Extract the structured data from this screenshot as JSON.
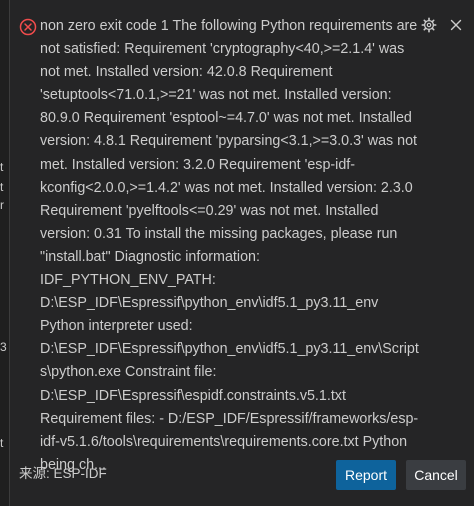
{
  "notification": {
    "severity": "error",
    "message": "non zero exit code 1 The following Python requirements are not satisfied: Requirement 'cryptography<40,>=2.1.4' was not met. Installed version: 42.0.8 Requirement 'setuptools<71.0.1,>=21' was not met. Installed version: 80.9.0 Requirement 'esptool~=4.7.0' was not met. Installed version: 4.8.1 Requirement 'pyparsing<3.1,>=3.0.3' was not met. Installed version: 3.2.0 Requirement 'esp-idf-kconfig<2.0.0,>=1.4.2' was not met. Installed version: 2.3.0 Requirement 'pyelftools<=0.29' was not met. Installed version: 0.31 To install the missing packages, please run \"install.bat\" Diagnostic information: IDF_PYTHON_ENV_PATH: D:\\ESP_IDF\\Espressif\\python_env\\idf5.1_py3.11_env Python interpreter used: D:\\ESP_IDF\\Espressif\\python_env\\idf5.1_py3.11_env\\Scripts\\python.exe Constraint file: D:\\ESP_IDF\\Espressif\\espidf.constraints.v5.1.txt Requirement files: - D:/ESP_IDF/Espressif/frameworks/esp-idf-v5.1.6/tools\\requirements\\requirements.core.txt Python being ch...",
    "source": "来源: ESP-IDF",
    "buttons": {
      "report": "Report",
      "cancel": "Cancel"
    },
    "icons": {
      "error": "error-circle-icon",
      "settings": "gear-icon",
      "close": "close-icon"
    },
    "colors": {
      "error": "#f14c4c",
      "primary_button": "#0e639c",
      "secondary_button": "#3a3d41",
      "background": "#252526",
      "text": "#cccccc"
    }
  }
}
